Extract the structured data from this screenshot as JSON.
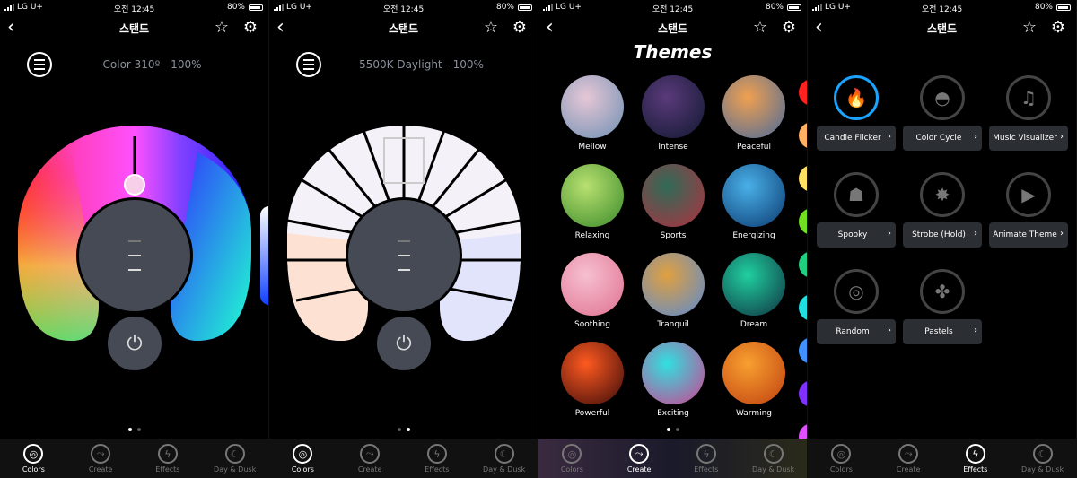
{
  "status": {
    "carrier": "LG U+",
    "time": "오전 12:45",
    "battery": "80%"
  },
  "nav": {
    "back": "‹",
    "title": "스탠드",
    "star": "☆",
    "gear": "⚙"
  },
  "screen1": {
    "label": "Color 310º - 100%"
  },
  "screen2": {
    "label": "5500K Daylight - 100%"
  },
  "themes": {
    "title": "Themes",
    "items": [
      {
        "label": "Mellow",
        "colors": [
          "#e6c7d6",
          "#6e8fb2"
        ]
      },
      {
        "label": "Intense",
        "colors": [
          "#5a3a7a",
          "#101830"
        ]
      },
      {
        "label": "Peaceful",
        "colors": [
          "#f0a050",
          "#4a6a9a"
        ]
      },
      {
        "label": "Relaxing",
        "colors": [
          "#b8e070",
          "#3a8a2a"
        ]
      },
      {
        "label": "Sports",
        "colors": [
          "#2f6b57",
          "#b03040"
        ]
      },
      {
        "label": "Energizing",
        "colors": [
          "#4ab0e8",
          "#0a3a70"
        ]
      },
      {
        "label": "Soothing",
        "colors": [
          "#f6c0d0",
          "#e07090"
        ]
      },
      {
        "label": "Tranquil",
        "colors": [
          "#e0a040",
          "#5a8ad0"
        ]
      },
      {
        "label": "Dream",
        "colors": [
          "#20d0a0",
          "#103040"
        ]
      },
      {
        "label": "Powerful",
        "colors": [
          "#ff5a20",
          "#3a0a0a"
        ]
      },
      {
        "label": "Exciting",
        "colors": [
          "#30e0e0",
          "#d04090"
        ]
      },
      {
        "label": "Warming",
        "colors": [
          "#f8a030",
          "#c04010"
        ]
      }
    ],
    "swatches": [
      "#ff2020",
      "#ffb060",
      "#ffe060",
      "#70e020",
      "#20d080",
      "#20e0e0",
      "#4090ff",
      "#8030ff",
      "#e050ff"
    ]
  },
  "effects": {
    "items": [
      {
        "label": "Candle Flicker",
        "icon": "🔥"
      },
      {
        "label": "Color Cycle",
        "icon": "◓"
      },
      {
        "label": "Music Visualizer",
        "icon": "♫"
      },
      {
        "label": "Spooky",
        "icon": "☗"
      },
      {
        "label": "Strobe (Hold)",
        "icon": "✸"
      },
      {
        "label": "Animate Theme",
        "icon": "▶"
      },
      {
        "label": "Random",
        "icon": "◎"
      },
      {
        "label": "Pastels",
        "icon": "✤"
      }
    ]
  },
  "tabs": [
    {
      "label": "Colors",
      "icon": "◎"
    },
    {
      "label": "Create",
      "icon": "⤳"
    },
    {
      "label": "Effects",
      "icon": "ϟ"
    },
    {
      "label": "Day & Dusk",
      "icon": "☾"
    }
  ],
  "accent": "#1aa3ff"
}
